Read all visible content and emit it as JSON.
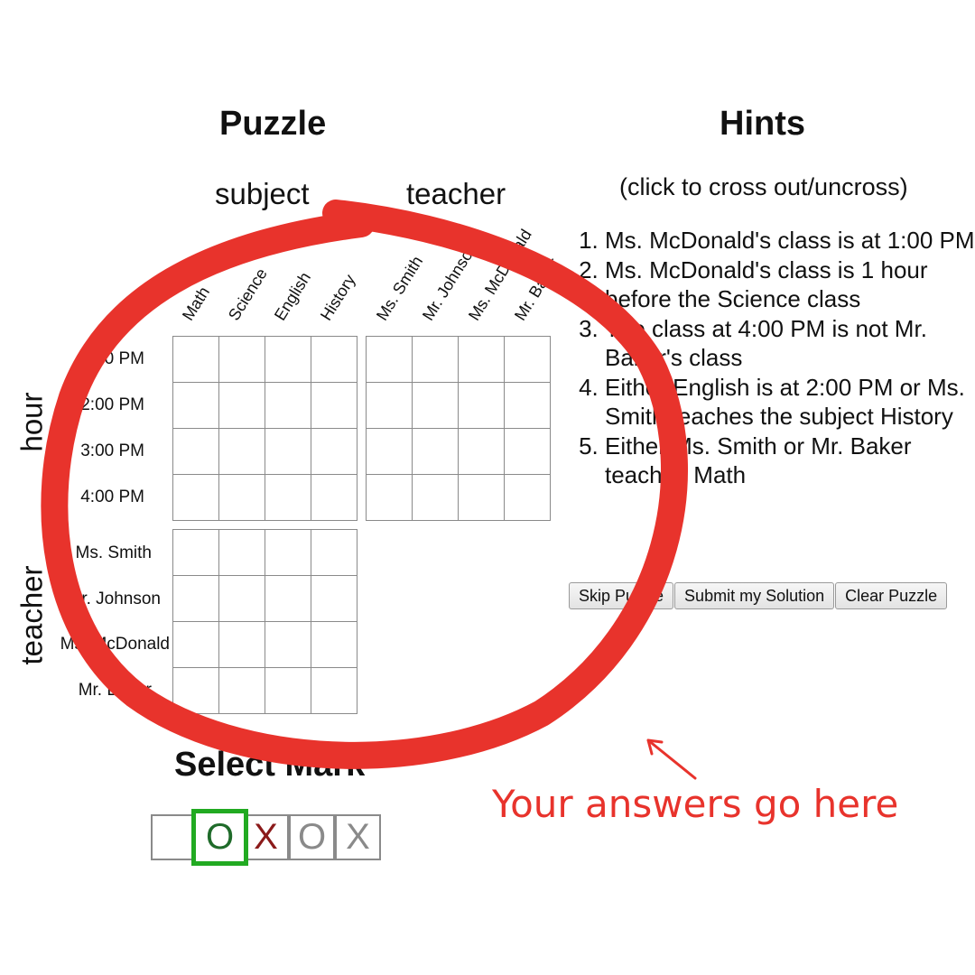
{
  "puzzle": {
    "heading": "Puzzle",
    "col_group_labels": [
      "subject",
      "teacher"
    ],
    "row_group_labels": [
      "hour",
      "teacher"
    ],
    "subject_columns": [
      "Math",
      "Science",
      "English",
      "History"
    ],
    "teacher_columns": [
      "Ms. Smith",
      "Mr. Johnson",
      "Ms. McDonald",
      "Mr. Baker"
    ],
    "hour_rows": [
      "1:00 PM",
      "2:00 PM",
      "3:00 PM",
      "4:00 PM"
    ],
    "teacher_rows": [
      "Ms. Smith",
      "Mr. Johnson",
      "Ms. McDonald",
      "Mr. Baker"
    ]
  },
  "hints": {
    "heading": "Hints",
    "subtitle": "(click to cross out/uncross)",
    "items": [
      "Ms. McDonald's class is at 1:00 PM",
      "Ms. McDonald's class is 1 hour before the Science class",
      "The class at 4:00 PM is not Mr. Baker's class",
      "Either English is at 2:00 PM or Ms. Smith teaches the subject History",
      "Either Ms. Smith or Mr. Baker teaches Math"
    ]
  },
  "buttons": {
    "skip": "Skip Puzzle",
    "submit": "Submit my Solution",
    "clear": "Clear Puzzle"
  },
  "select_mark": {
    "heading": "Select Mark",
    "marks": [
      "",
      "O",
      "X",
      "O",
      "X"
    ],
    "mark_colors": [
      "#000000",
      "#1f6b2a",
      "#8b1a1a",
      "#8a8a8a",
      "#8a8a8a"
    ],
    "selected_index": 1,
    "selected_color": "#22aa22"
  },
  "annotation": {
    "text": "Your answers go here",
    "color": "#e8332c"
  }
}
